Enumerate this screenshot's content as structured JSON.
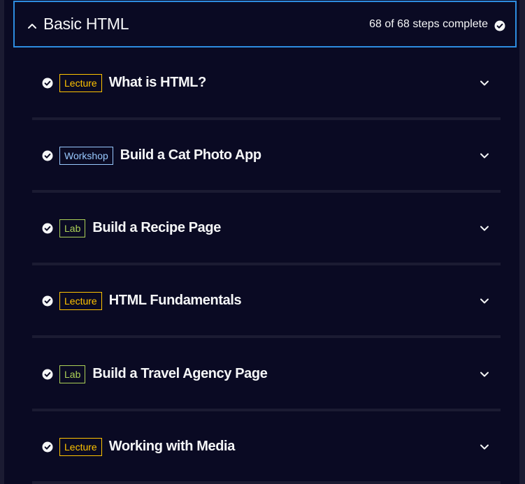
{
  "block": {
    "title": "Basic HTML",
    "progress": "68 of 68 steps complete",
    "accent_color": "#2d8ce0",
    "expanded": true
  },
  "modules": [
    {
      "tag": "Lecture",
      "tag_type": "lecture",
      "title": "What is HTML?",
      "completed": true
    },
    {
      "tag": "Workshop",
      "tag_type": "workshop",
      "title": "Build a Cat Photo App",
      "completed": true
    },
    {
      "tag": "Lab",
      "tag_type": "lab",
      "title": "Build a Recipe Page",
      "completed": true
    },
    {
      "tag": "Lecture",
      "tag_type": "lecture",
      "title": "HTML Fundamentals",
      "completed": true
    },
    {
      "tag": "Lab",
      "tag_type": "lab",
      "title": "Build a Travel Agency Page",
      "completed": true
    },
    {
      "tag": "Lecture",
      "tag_type": "lecture",
      "title": "Working with Media",
      "completed": true
    }
  ],
  "colors": {
    "background": "#0a0a23",
    "divider": "#1b1b32",
    "text": "#f5f6f7",
    "lecture": "#ffc300",
    "workshop": "#99c9ff",
    "lab": "#acd157"
  },
  "icons": {
    "header_toggle": "caret-up-icon",
    "progress": "check-circle-icon",
    "module_status": "check-circle-icon",
    "module_toggle": "chevron-down-icon"
  }
}
